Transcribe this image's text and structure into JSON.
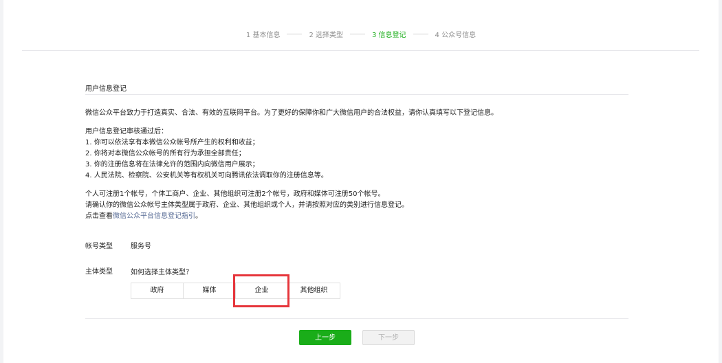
{
  "steps": [
    {
      "label": "1 基本信息",
      "active": false
    },
    {
      "label": "2 选择类型",
      "active": false
    },
    {
      "label": "3 信息登记",
      "active": true
    },
    {
      "label": "4 公众号信息",
      "active": false
    }
  ],
  "section": {
    "title": "用户信息登记"
  },
  "intro": "微信公众平台致力于打造真实、合法、有效的互联网平台。为了更好的保障你和广大微信用户的合法权益，请你认真填写以下登记信息。",
  "rules": {
    "heading": "用户信息登记审核通过后：",
    "items": [
      "1. 你可以依法享有本微信公众帐号所产生的权利和收益；",
      "2. 你将对本微信公众帐号的所有行为承担全部责任；",
      "3. 你的注册信息将在法律允许的范围内向微信用户展示；",
      "4. 人民法院、检察院、公安机关等有权机关可向腾讯依法调取你的注册信息等。"
    ]
  },
  "notes": {
    "line1": "个人可注册1个帐号，个体工商户、企业、其他组织可注册2个帐号，政府和媒体可注册50个帐号。",
    "line2": "请确认你的微信公众帐号主体类型属于政府、企业、其他组织或个人，并请按照对应的类别进行信息登记。",
    "line3_prefix": "点击查看",
    "line3_link": "微信公众平台信息登记指引",
    "line3_suffix": "。"
  },
  "account_type": {
    "label": "帐号类型",
    "value": "服务号"
  },
  "subject_type": {
    "label": "主体类型",
    "help_link": "如何选择主体类型？",
    "options": [
      "政府",
      "媒体",
      "企业",
      "其他组织"
    ],
    "selected": "企业"
  },
  "buttons": {
    "prev": "上一步",
    "next": "下一步"
  },
  "colors": {
    "accent": "#1aad19",
    "link": "#576b95",
    "highlight": "#e6353b"
  }
}
